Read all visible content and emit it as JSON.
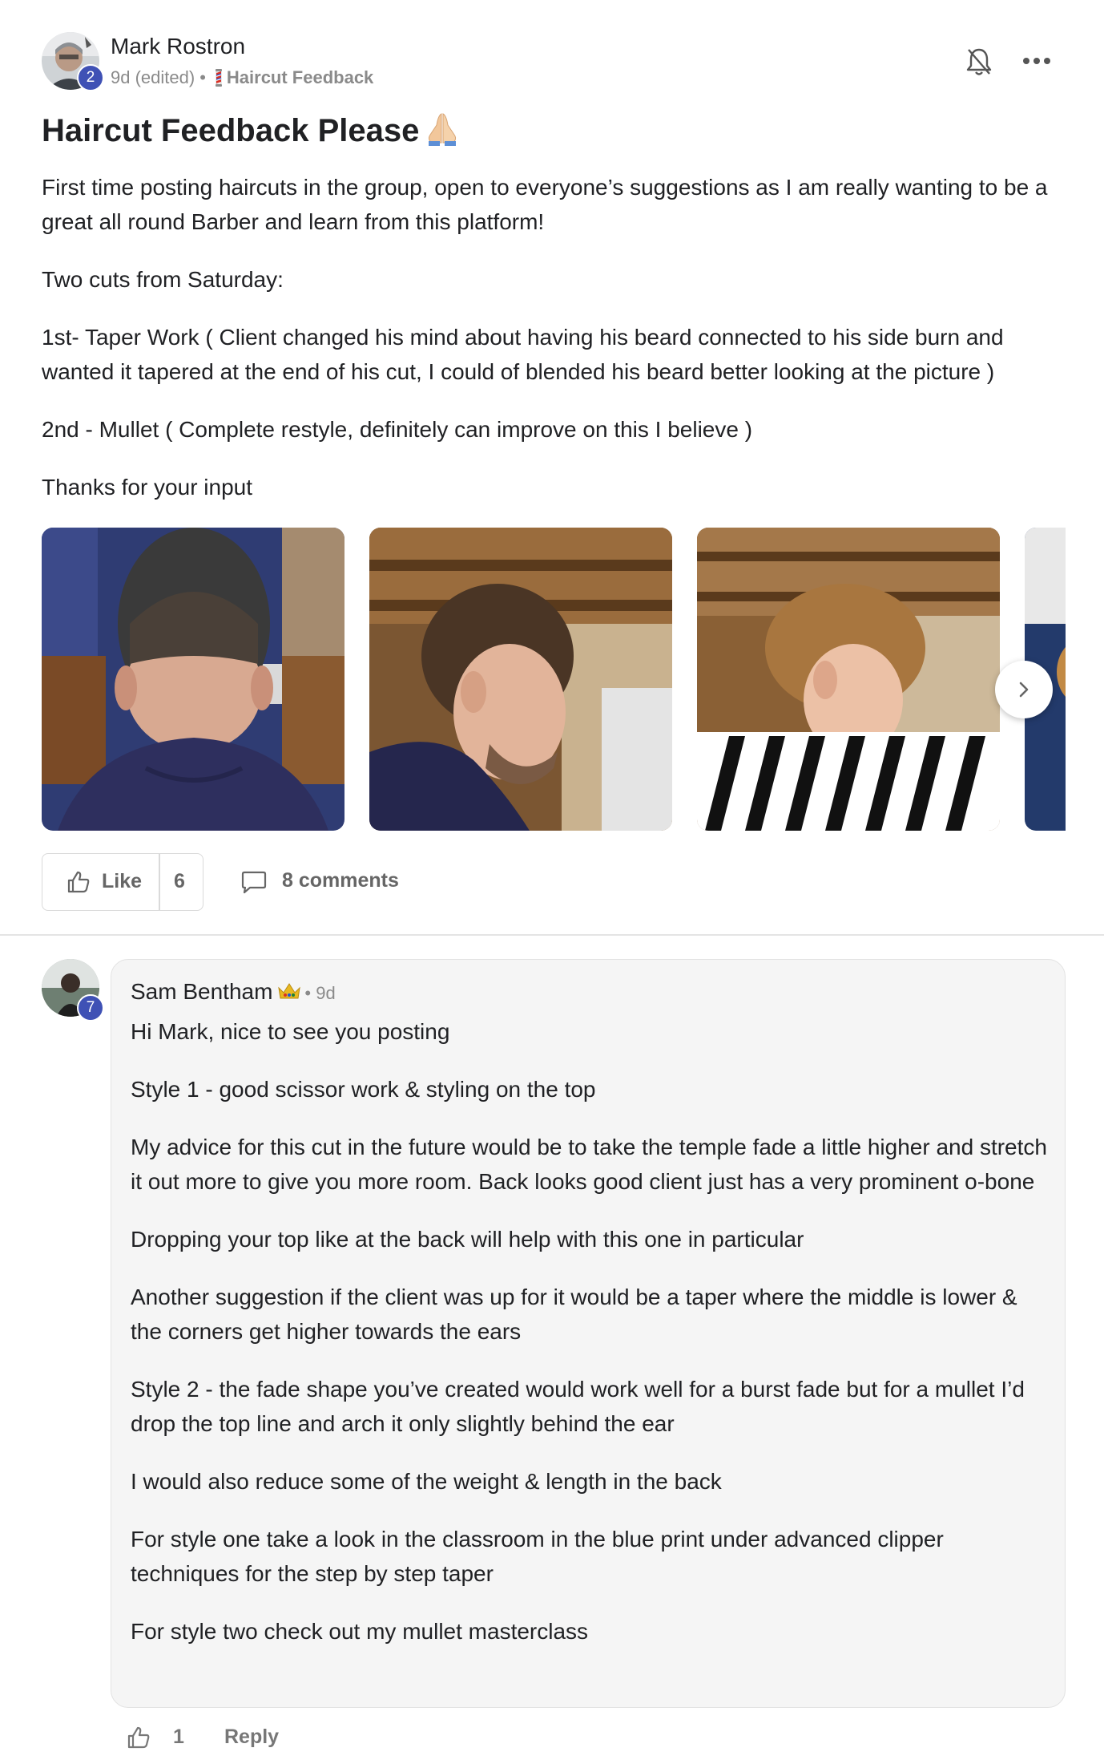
{
  "post": {
    "author": "Mark Rostron",
    "author_level": "2",
    "meta": {
      "time": "9d (edited)",
      "separator": "•",
      "category": "Haircut Feedback"
    },
    "title": "Haircut Feedback Please",
    "body": [
      "First time posting haircuts in the group, open to everyone’s suggestions as I am really wanting to be a great all round Barber and learn from this platform!",
      "Two cuts from Saturday:",
      "1st- Taper Work ( Client changed his mind about having his beard connected to his side burn and wanted it tapered at the end of his cut, I could of blended his beard better looking at the picture )",
      "2nd - Mullet ( Complete restyle, definitely can improve on this I believe )",
      "Thanks for your input"
    ],
    "photos": [
      {
        "name": "photo-taper-back"
      },
      {
        "name": "photo-taper-side"
      },
      {
        "name": "photo-mullet-side"
      },
      {
        "name": "photo-partial"
      }
    ],
    "actions": {
      "like_label": "Like",
      "like_count": "6",
      "comments_label": "8 comments"
    },
    "icons": [
      "bell-off-icon",
      "more-options-icon",
      "chevron-right-icon",
      "thumb-up-icon",
      "comment-icon",
      "barber-pole-icon",
      "praying-hands-icon"
    ]
  },
  "comment": {
    "author": "Sam Bentham",
    "author_level": "7",
    "separator": "•",
    "time": "9d",
    "body": [
      "Hi Mark, nice to see you posting",
      "Style 1 - good scissor work & styling on the top",
      "My advice for this cut in the future would be to take the temple fade a little higher and stretch it out more to give you more room. Back looks good client just has a very prominent o-bone",
      "Dropping your top like at the back will help with this one in particular",
      "Another suggestion if the client was up for it would be a taper where the middle is lower & the corners get higher towards the ears",
      "Style 2 - the fade shape you’ve created would work well for a burst fade but for a mullet I’d drop the top line and arch it only slightly behind the ear",
      "I would also reduce some of the weight & length in the back",
      "For style one take a look in the classroom in the blue print under advanced clipper techniques for the step by step taper",
      "For style two check out my mullet masterclass"
    ],
    "like_count": "1",
    "reply_label": "Reply"
  },
  "colors": {
    "badge": "#3f51b5",
    "muted_text": "#8a8a8a",
    "bubble_bg": "#f5f5f5"
  }
}
